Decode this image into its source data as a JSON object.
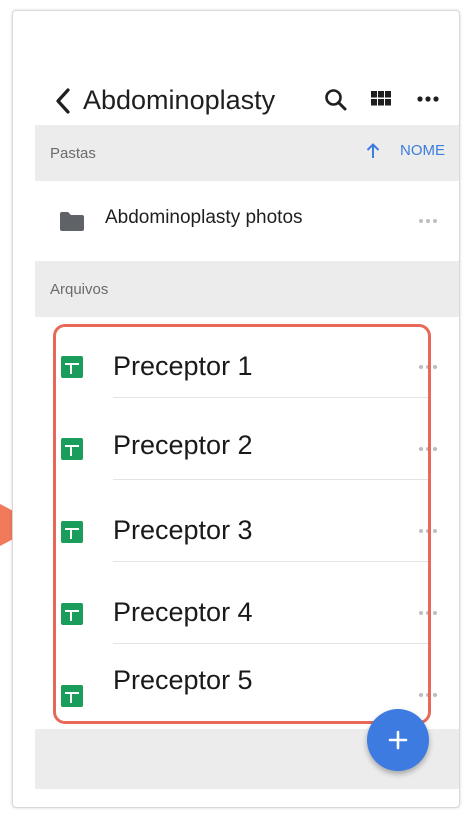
{
  "header": {
    "title": "Abdominoplasty",
    "back_icon": "chevron-left-icon",
    "search_icon": "search-icon",
    "grid_icon": "grid-view-icon",
    "more_icon": "more-horizontal-icon"
  },
  "folders_section": {
    "label": "Pastas",
    "sort_label": "NOME",
    "sort_icon": "arrow-up-icon"
  },
  "folders": [
    {
      "name": "Abdominoplasty photos",
      "icon": "folder-icon"
    }
  ],
  "files_section": {
    "label": "Arquivos"
  },
  "files": [
    {
      "name": "Preceptor 1",
      "icon": "google-sheets-icon"
    },
    {
      "name": "Preceptor 2",
      "icon": "google-sheets-icon"
    },
    {
      "name": "Preceptor 3",
      "icon": "google-sheets-icon"
    },
    {
      "name": "Preceptor 4",
      "icon": "google-sheets-icon"
    },
    {
      "name": "Preceptor 5",
      "icon": "google-sheets-icon"
    }
  ],
  "fab": {
    "icon": "plus-icon"
  },
  "colors": {
    "accent": "#3d7be0",
    "sheets_green": "#1a9d5a",
    "highlight": "#e8695a",
    "arrow": "#f07a5a"
  }
}
